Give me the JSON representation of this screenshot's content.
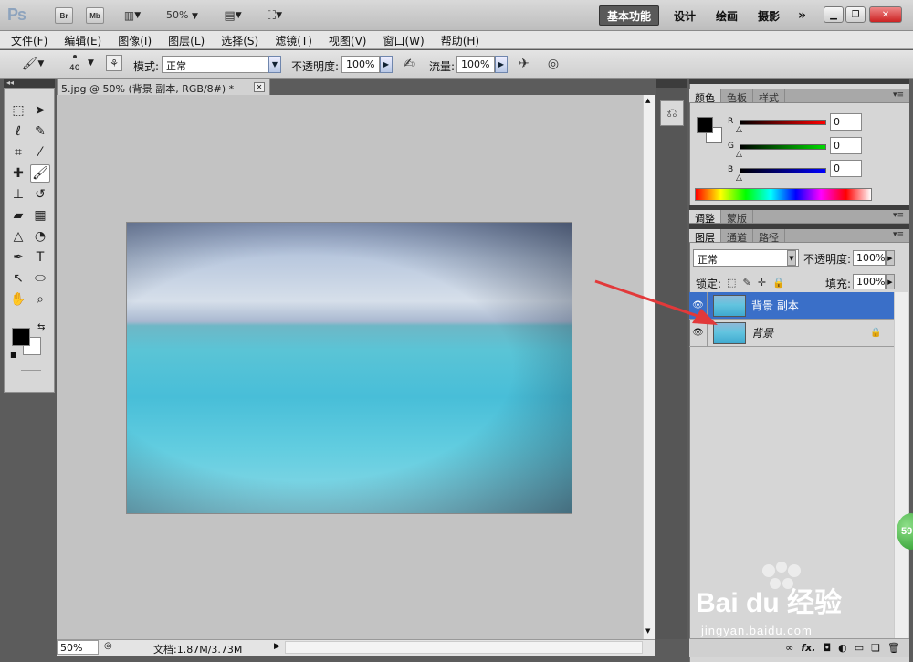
{
  "appbar": {
    "logo": "Ps",
    "bridge": "Br",
    "minibridge": "Mb",
    "zoom": "50%",
    "workspaces": [
      "基本功能",
      "设计",
      "绘画",
      "摄影"
    ],
    "more": "»"
  },
  "menu": [
    "文件(F)",
    "编辑(E)",
    "图像(I)",
    "图层(L)",
    "选择(S)",
    "滤镜(T)",
    "视图(V)",
    "窗口(W)",
    "帮助(H)"
  ],
  "options": {
    "brush_size": "40",
    "mode_label": "模式:",
    "mode_value": "正常",
    "opacity_label": "不透明度:",
    "opacity_value": "100%",
    "flow_label": "流量:",
    "flow_value": "100%"
  },
  "document": {
    "tab_title": "5.jpg @ 50% (背景 副本, RGB/8#) *",
    "status_zoom": "50%",
    "status_doc": "文档:1.87M/3.73M"
  },
  "panels": {
    "color_tabs": [
      "颜色",
      "色板",
      "样式"
    ],
    "color": {
      "r_label": "R",
      "g_label": "G",
      "b_label": "B",
      "r_value": "0",
      "g_value": "0",
      "b_value": "0",
      "fg": "#000000",
      "bg": "#ffffff"
    },
    "adjust_tabs": [
      "调整",
      "蒙版"
    ],
    "layer_tabs": [
      "图层",
      "通道",
      "路径"
    ],
    "layers": {
      "blend": "正常",
      "opacity_label": "不透明度:",
      "opacity_value": "100%",
      "lock_label": "锁定:",
      "fill_label": "填充:",
      "fill_value": "100%",
      "items": [
        {
          "name": "背景 副本",
          "selected": true
        },
        {
          "name": "背景",
          "selected": false,
          "locked": true
        }
      ]
    }
  },
  "badge": "59",
  "watermark": {
    "brand": "Bai du 经验",
    "url": "jingyan.baidu.com"
  },
  "colors": {
    "selection": "#3a6fc8",
    "canvas": "#c3c3c3",
    "arrow": "#e2393a"
  },
  "icons": [
    "brush-icon",
    "marquee-icon",
    "move-icon",
    "lasso-icon",
    "quick-select-icon",
    "crop-icon",
    "eyedropper-icon",
    "healing-icon",
    "brush-tool-icon",
    "stamp-icon",
    "history-brush-icon",
    "eraser-icon",
    "gradient-icon",
    "blur-icon",
    "dodge-icon",
    "pen-icon",
    "type-icon",
    "path-select-icon",
    "shape-icon",
    "hand-icon",
    "zoom-icon",
    "eye-icon",
    "lock-icon",
    "link-icon",
    "fx-icon",
    "mask-icon",
    "adjustment-icon",
    "folder-icon",
    "new-layer-icon",
    "trash-icon"
  ]
}
